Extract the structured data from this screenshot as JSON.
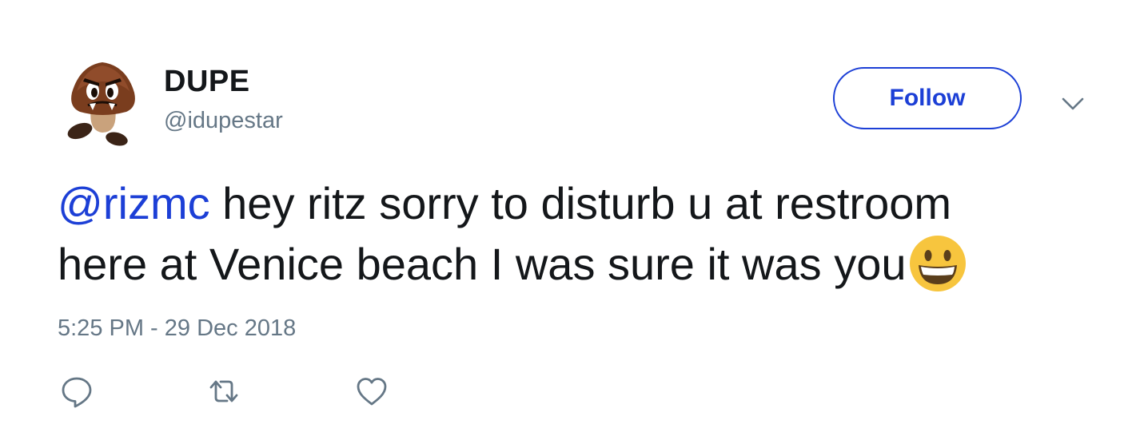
{
  "user": {
    "display_name": "DUPE",
    "handle": "@idupestar",
    "avatar_icon": "goomba-avatar"
  },
  "follow_button": {
    "label": "Follow"
  },
  "menu": {
    "icon": "chevron-down-icon"
  },
  "tweet": {
    "mention": "@rizmc",
    "text_line1_rest": " hey ritz sorry to disturb u at restroom",
    "text_line2": "here at Venice beach I was sure it was you",
    "emoji": "grinning-face-emoji",
    "timestamp": "5:25 PM - 29 Dec 2018"
  },
  "actions": [
    {
      "icon": "reply-icon"
    },
    {
      "icon": "retweet-icon"
    },
    {
      "icon": "like-icon"
    }
  ],
  "colors": {
    "text": "#14171a",
    "secondary": "#657786",
    "link": "#1c3fd6",
    "icon": "#657786"
  }
}
